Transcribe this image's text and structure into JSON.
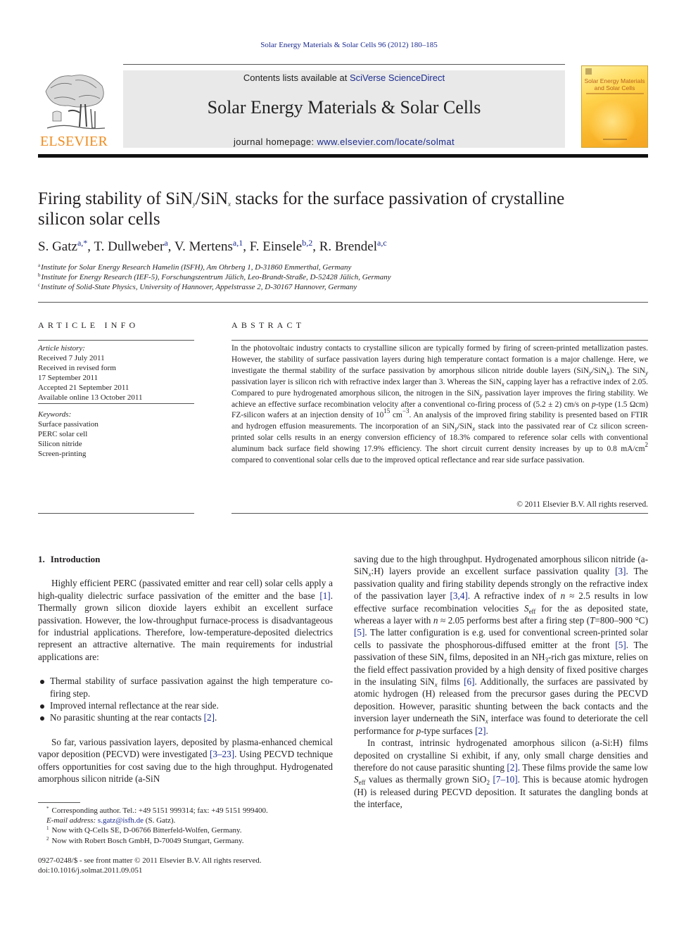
{
  "journal_citation": "Solar Energy Materials & Solar Cells 96 (2012) 180–185",
  "banner": {
    "contents_prefix": "Contents lists available at ",
    "contents_link": "SciVerse ScienceDirect",
    "journal_title": "Solar Energy Materials & Solar Cells",
    "homepage_prefix": "journal homepage: ",
    "homepage_link": "www.elsevier.com/locate/solmat"
  },
  "publisher_logo": {
    "word": "ELSEVIER",
    "icon": "tree-icon",
    "color": "#f08c1e"
  },
  "cover": {
    "title_line1": "Solar Energy Materials",
    "title_line2": "and Solar Cells"
  },
  "article": {
    "title_part1": "Firing stability of SiN",
    "title_sub_y": "y",
    "title_part2": "/SiN",
    "title_sub_x": "x",
    "title_part3": " stacks for the surface passivation of crystalline",
    "title_line2": "silicon solar cells",
    "authors": [
      {
        "name": "S. Gatz",
        "sup": "a,*"
      },
      {
        "name": "T. Dullweber",
        "sup": "a"
      },
      {
        "name": "V. Mertens",
        "sup": "a,1"
      },
      {
        "name": "F. Einsele",
        "sup": "b,2"
      },
      {
        "name": "R. Brendel",
        "sup": "a,c"
      }
    ],
    "affiliations": [
      {
        "key": "a",
        "text": "Institute for Solar Energy Research Hamelin (ISFH), Am Ohrberg 1, D-31860 Emmerthal, Germany"
      },
      {
        "key": "b",
        "text": "Institute for Energy Research (IEF-5), Forschungszentrum Jülich, Leo-Brandt-Straße, D-52428 Jülich, Germany"
      },
      {
        "key": "c",
        "text": "Institute of Solid-State Physics, University of Hannover, Appelstrasse 2, D-30167 Hannover, Germany"
      }
    ]
  },
  "article_info": {
    "heading": "ARTICLE INFO",
    "history_label": "Article history:",
    "history": [
      "Received 7 July 2011",
      "Received in revised form",
      "17 September 2011",
      "Accepted 21 September 2011",
      "Available online 13 October 2011"
    ],
    "keywords_label": "Keywords:",
    "keywords": [
      "Surface passivation",
      "PERC solar cell",
      "Silicon nitride",
      "Screen-printing"
    ]
  },
  "abstract": {
    "heading": "ABSTRACT",
    "t1": "In the photovoltaic industry contacts to crystalline silicon are typically formed by firing of screen-printed metallization pastes. However, the stability of surface passivation layers during high temperature contact formation is a major challenge. Here, we investigate the thermal stability of the surface passivation by amorphous silicon nitride double layers (SiN",
    "t2": "/SiN",
    "t3": "). The SiN",
    "t4": " passivation layer is silicon rich with refractive index larger than 3. Whereas the SiN",
    "t5": " capping layer has a refractive index of 2.05. Compared to pure hydrogenated amorphous silicon, the nitrogen in the SiN",
    "t6": " passivation layer improves the firing stability. We achieve an effective surface recombination velocity after a conventional co-firing process of (5.2 ± 2) cm/s on ",
    "t7": "p",
    "t8": "-type (1.5 Ωcm) FZ-silicon wafers at an injection density of 10",
    "t9": "15",
    "t10": " cm",
    "t11": "−3",
    "t12": ". An analysis of the improved firing stability is presented based on FTIR and hydrogen effusion measurements. The incorporation of an SiN",
    "t13": "/SiN",
    "t14": " stack into the passivated rear of Cz silicon screen-printed solar cells results in an energy conversion efficiency of 18.3% compared to reference solar cells with conventional aluminum back surface field showing 17.9% efficiency. The short circuit current density increases by up to 0.8 mA/cm",
    "t15": "2",
    "t16": " compared to conventional solar cells due to the improved optical reflectance and rear side surface passivation.",
    "sub_y": "y",
    "sub_x": "x",
    "copyright": "© 2011 Elsevier B.V. All rights reserved."
  },
  "intro": {
    "section_num": "1.",
    "section_title": "Introduction",
    "p1a": "Highly efficient PERC (passivated emitter and rear cell) solar cells apply a high-quality dielectric surface passivation of the emitter and the base ",
    "ref1": "[1]",
    "p1b": ". Thermally grown silicon dioxide layers exhibit an excellent surface passivation. However, the low-throughput furnace-process is disadvantageous for industrial applications. Therefore, low-temperature-deposited dielectrics represent an attractive alternative. The main requirements for industrial applications are:",
    "bullets": [
      "Thermal stability of surface passivation against the high temperature co-firing step.",
      "Improved internal reflectance at the rear side.",
      "No parasitic shunting at the rear contacts "
    ],
    "bullet3_ref": "[2]",
    "p2a": "So far, various passivation layers, deposited by plasma-enhanced chemical vapor deposition (PECVD) were investigated ",
    "ref3_23": "[3–23]",
    "p2b": ". Using PECVD technique offers opportunities for cost saving due to the high throughput. Hydrogenated amorphous silicon nitride (a-SiN",
    "p2c": ":H) layers provide an excellent surface passivation quality ",
    "ref3": "[3]",
    "p2d": ". The passivation quality and firing stability depends strongly on the refractive index of the passivation layer ",
    "ref34": "[3,4]",
    "p2e": ". A refractive index of ",
    "n": "n",
    "p2f": " ≈ 2.5 results in low effective surface recombination velocities ",
    "S": "S",
    "eff": "eff",
    "p2g": " for the as deposited state, whereas a layer with ",
    "p2h": " ≈ 2.05 performs best after a firing step (",
    "T": "T",
    "p2i": "=800–900 °C) ",
    "ref5": "[5]",
    "p2j": ". The latter configuration is e.g. used for conventional screen-printed solar cells to passivate the phosphorous-diffused emitter at the front ",
    "p2k": ". The passivation of these SiN",
    "p2l": " films, deposited in an NH",
    "nh3": "3",
    "p2m": "-rich gas mixture, relies on the field effect passivation provided by a high density of fixed positive charges in the insulating SiN",
    "p2n": " films ",
    "ref6": "[6]",
    "p2o": ". Additionally, the surfaces are passivated by atomic hydrogen (H) released from the precursor gases during the PECVD deposition. However, parasitic shunting between the back contacts and the inversion layer underneath the SiN",
    "p2p": " interface was found to deteriorate the cell performance for ",
    "p": "p",
    "p2q": "-type surfaces ",
    "ref2": "[2]",
    "p3a": "In contrast, intrinsic hydrogenated amorphous silicon (a-Si:H) films deposited on crystalline Si exhibit, if any, only small charge densities and therefore do not cause parasitic shunting ",
    "p3b": ". These films provide the same low ",
    "p3c": " values as thermally grown SiO",
    "sio2": "2",
    "ref7_10": "[7–10]",
    "p3d": ". This is because atomic hydrogen (H) is released during PECVD deposition. It saturates the dangling bonds at the interface,",
    "x": "x"
  },
  "footnotes": {
    "corresponding": "Corresponding author. Tel.: +49 5151 999314; fax: +49 5151 999400.",
    "email_label": "E-mail address:",
    "email": "s.gatz@isfh.de",
    "email_suffix": " (S. Gatz).",
    "fn1": "Now with Q-Cells SE, D-06766 Bitterfeld-Wolfen, Germany.",
    "fn2": "Now with Robert Bosch GmbH, D-70049 Stuttgart, Germany."
  },
  "front_matter": {
    "issn_line": "0927-0248/$ - see front matter © 2011 Elsevier B.V. All rights reserved.",
    "doi": "doi:10.1016/j.solmat.2011.09.051"
  }
}
